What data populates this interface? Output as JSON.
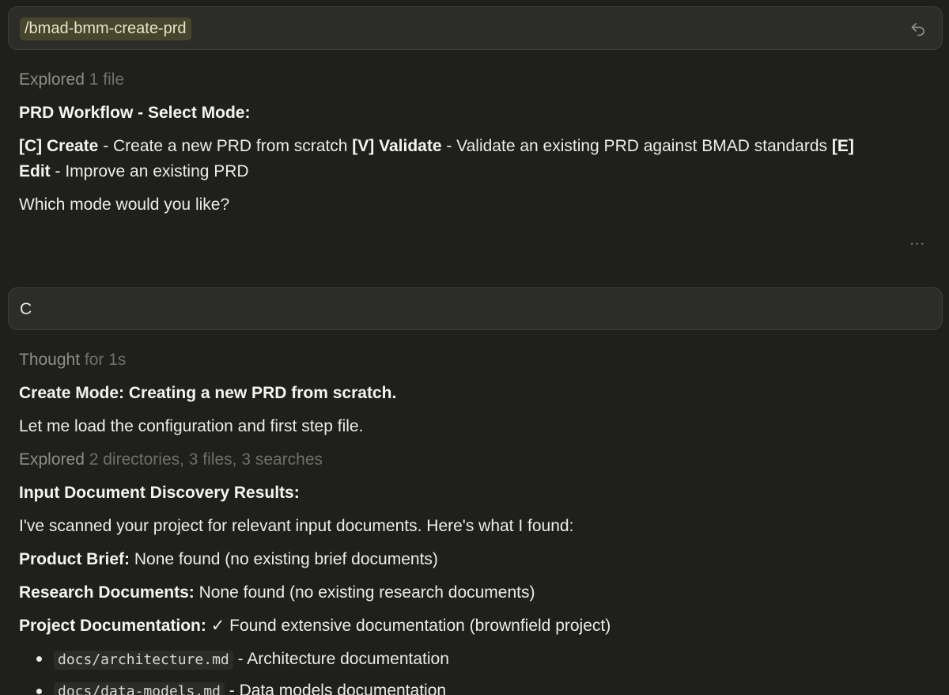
{
  "first_message": {
    "command": "/bmad-bmm-create-prd",
    "undo_icon": "undo-arrow-icon"
  },
  "response_1": {
    "explored_label": "Explored",
    "explored_detail": "1 file",
    "heading": "PRD Workflow - Select Mode:",
    "mode_c_key": "[C] Create",
    "mode_c_desc": " - Create a new PRD from scratch ",
    "mode_v_key": "[V] Validate",
    "mode_v_desc": " - Validate an existing PRD against BMAD standards ",
    "mode_e_key_part1": "[E]",
    "mode_e_key_part2": "Edit",
    "mode_e_desc": " - Improve an existing PRD",
    "question": "Which mode would you like?",
    "more_menu": "..."
  },
  "second_message": {
    "text": "C"
  },
  "response_2": {
    "thought_label": "Thought",
    "thought_detail": "for 1s",
    "heading": "Create Mode: Creating a new PRD from scratch.",
    "line_load": "Let me load the configuration and first step file.",
    "explored_label": "Explored",
    "explored_detail": "2 directories, 3 files, 3 searches",
    "discovery_heading": "Input Document Discovery Results:",
    "scan_line": "I've scanned your project for relevant input documents. Here's what I found:",
    "product_brief_label": "Product Brief:",
    "product_brief_value": " None found (no existing brief documents)",
    "research_label": "Research Documents:",
    "research_value": " None found (no existing research documents)",
    "project_doc_label": "Project Documentation:",
    "project_doc_value": " ✓ Found extensive documentation (brownfield project)",
    "docs": [
      {
        "file": "docs/architecture.md",
        "desc": " - Architecture documentation"
      },
      {
        "file": "docs/data-models.md",
        "desc": " - Data models documentation"
      }
    ]
  }
}
